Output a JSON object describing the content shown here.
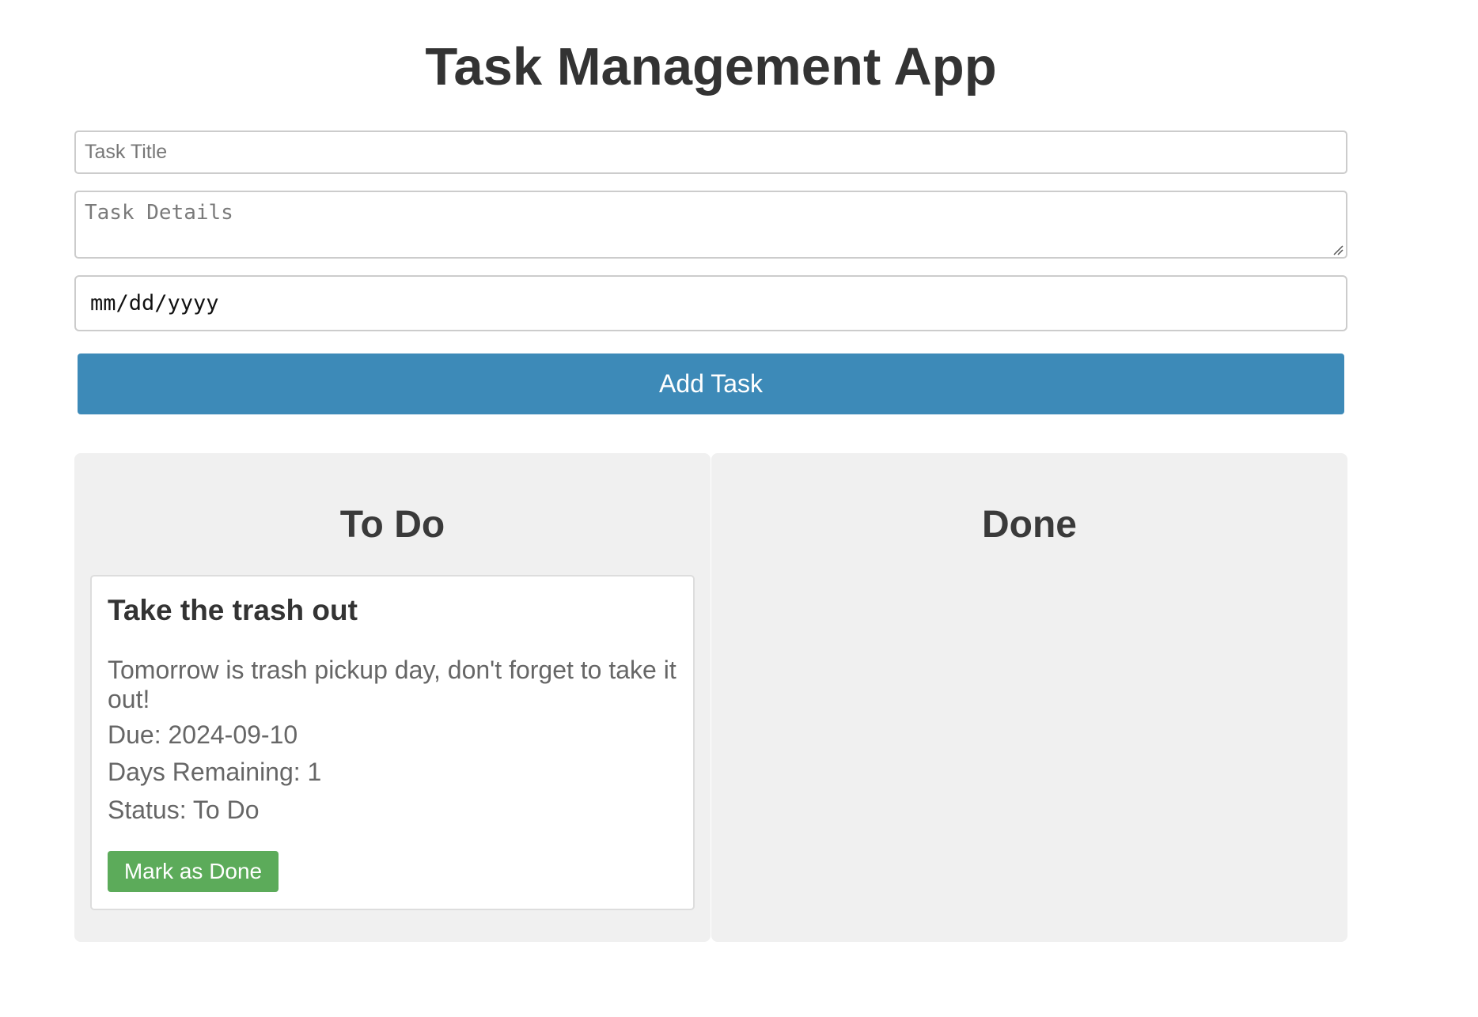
{
  "app": {
    "title": "Task Management App"
  },
  "form": {
    "title_placeholder": "Task Title",
    "title_value": "",
    "details_placeholder": "Task Details",
    "details_value": "",
    "date_placeholder": "mm/dd/yyyy",
    "add_button_label": "Add Task"
  },
  "columns": {
    "todo": {
      "title": "To Do",
      "tasks": [
        {
          "title": "Take the trash out",
          "details": "Tomorrow is trash pickup day, don't forget to take it out!",
          "due_label": "Due:",
          "due": "2024-09-10",
          "remaining_label": "Days Remaining:",
          "remaining": "1",
          "status_label": "Status:",
          "status": "To Do",
          "action_label": "Mark as Done"
        }
      ]
    },
    "done": {
      "title": "Done",
      "tasks": []
    }
  },
  "colors": {
    "primary": "#3d8ab8",
    "success": "#5cab5a",
    "column_bg": "#f0f0f0"
  }
}
